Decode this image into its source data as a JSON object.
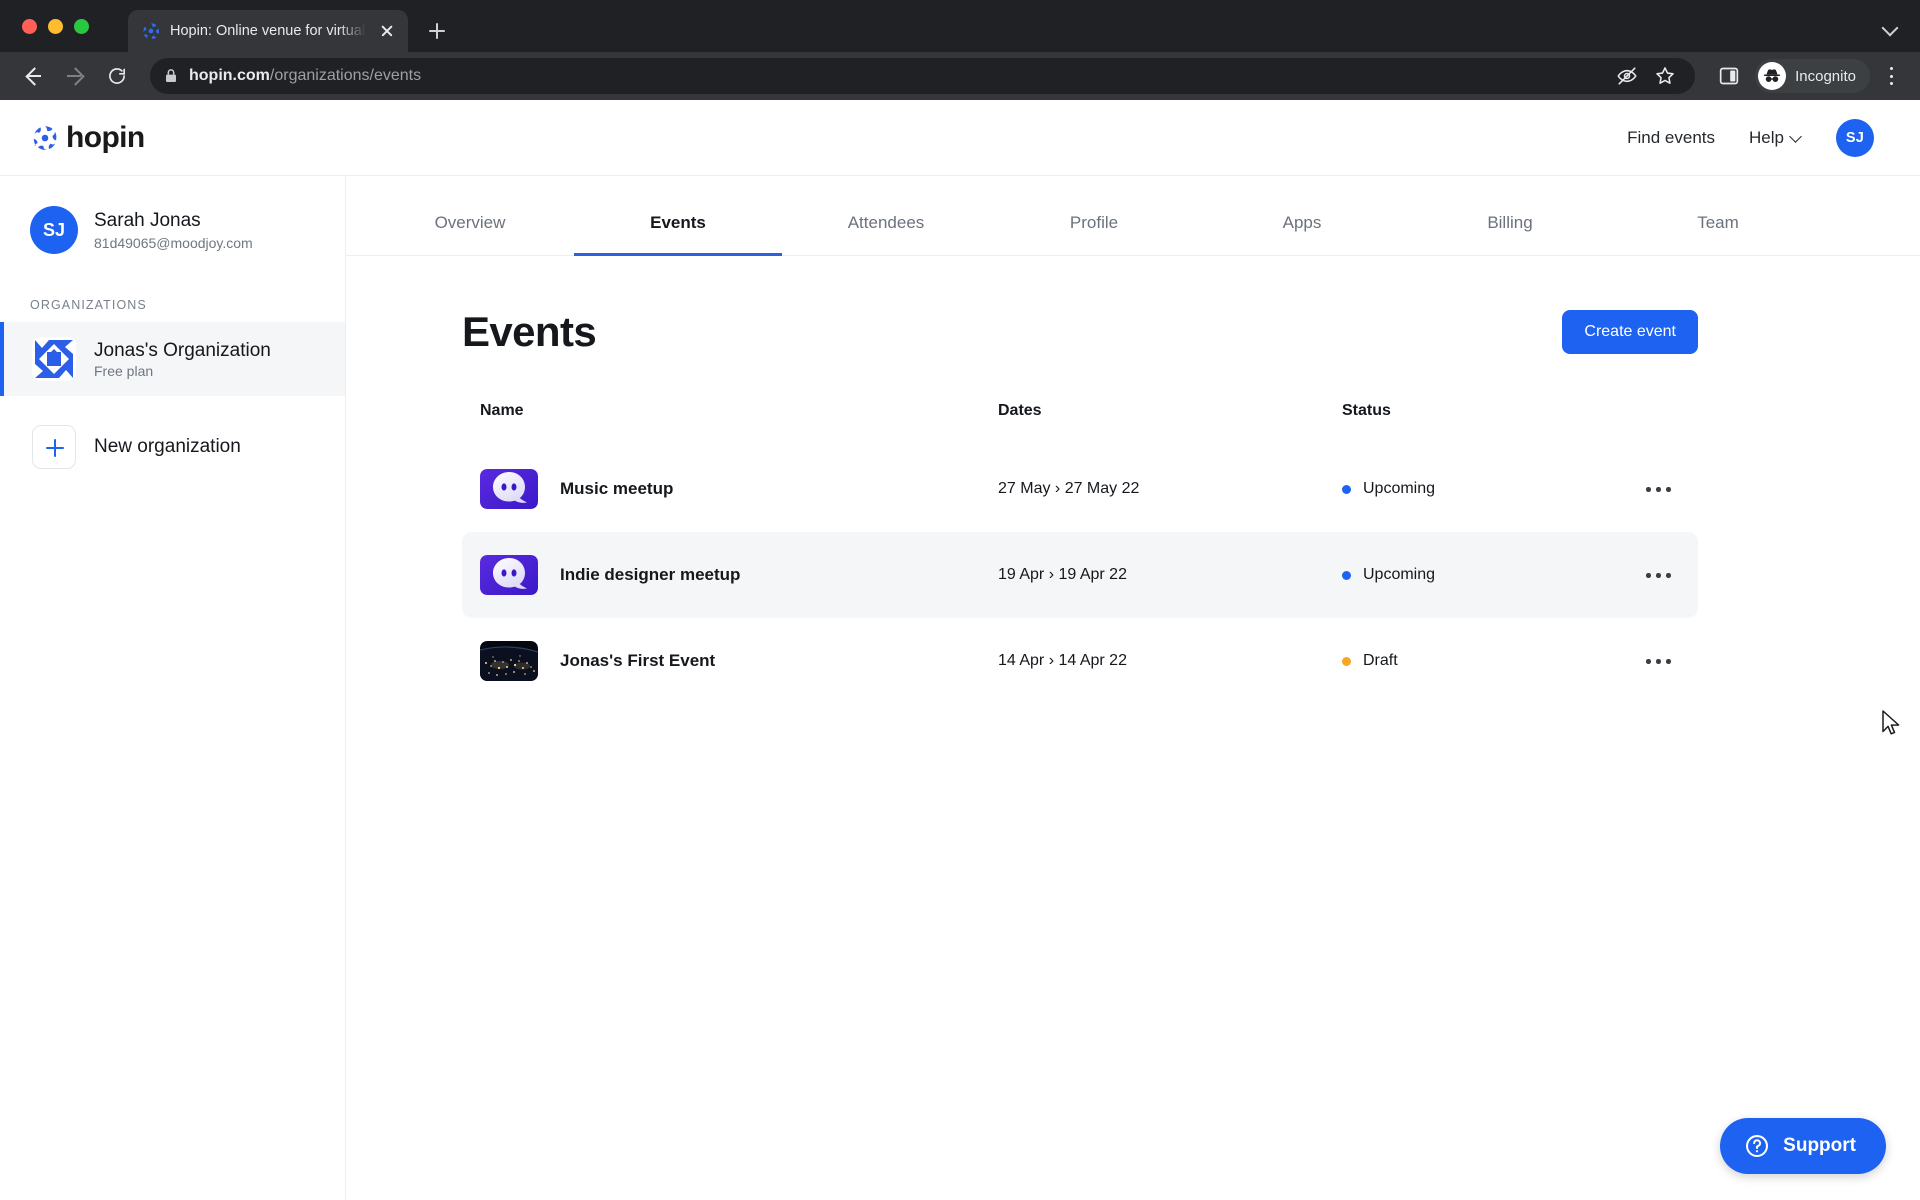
{
  "browser": {
    "tab": {
      "title": "Hopin: Online venue for virtual",
      "favicon_icon": "hopin-favicon-icon",
      "close_icon": "close-icon"
    },
    "new_tab_icon": "plus-icon",
    "tab_list_icon": "chevron-down-icon",
    "back_icon": "back-arrow-icon",
    "forward_icon": "forward-arrow-icon",
    "reload_icon": "reload-icon",
    "lock_icon": "lock-icon",
    "url_domain": "hopin.com",
    "url_path": "/organizations/events",
    "third_party_cookie_icon": "eye-slash-icon",
    "bookmark_icon": "star-icon",
    "side_panel_icon": "side-panel-icon",
    "incognito_icon": "incognito-hat-icon",
    "incognito_label": "Incognito",
    "menu_icon": "three-dot-menu-icon"
  },
  "topbar": {
    "logo_icon": "hopin-swirl-icon",
    "brand": "hopin",
    "find_events": "Find events",
    "help": "Help",
    "help_chevron_icon": "chevron-down-icon",
    "avatar_initials": "SJ",
    "accent": "#1d62f0"
  },
  "sidebar": {
    "user": {
      "initials": "SJ",
      "name": "Sarah Jonas",
      "email": "81d49065@moodjoy.com"
    },
    "section_label": "ORGANIZATIONS",
    "organization": {
      "name": "Jonas's Organization",
      "plan": "Free plan",
      "thumb_icon": "organization-pinwheel-icon",
      "selected": true
    },
    "new_organization": {
      "label": "New organization",
      "icon": "plus-icon"
    }
  },
  "main": {
    "tabs": [
      {
        "label": "Overview",
        "active": false
      },
      {
        "label": "Events",
        "active": true
      },
      {
        "label": "Attendees",
        "active": false
      },
      {
        "label": "Profile",
        "active": false
      },
      {
        "label": "Apps",
        "active": false
      },
      {
        "label": "Billing",
        "active": false
      },
      {
        "label": "Team",
        "active": false
      }
    ],
    "page_title": "Events",
    "create_button": "Create event",
    "table": {
      "columns": [
        "Name",
        "Dates",
        "Status"
      ],
      "rows": [
        {
          "name": "Music meetup",
          "dates": "27 May › 27 May 22",
          "status": "Upcoming",
          "status_color": "#1d62f0",
          "thumb": "ghost-purple",
          "hovered": false,
          "actions_icon": "more-options-icon"
        },
        {
          "name": "Indie designer meetup",
          "dates": "19 Apr › 19 Apr 22",
          "status": "Upcoming",
          "status_color": "#1d62f0",
          "thumb": "ghost-purple",
          "hovered": true,
          "actions_icon": "more-options-icon"
        },
        {
          "name": "Jonas's First Event",
          "dates": "14 Apr › 14 Apr 22",
          "status": "Draft",
          "status_color": "#f5a623",
          "thumb": "earth-night",
          "hovered": false,
          "actions_icon": "more-options-icon"
        }
      ]
    }
  },
  "support": {
    "label": "Support",
    "icon": "question-circle-icon"
  }
}
